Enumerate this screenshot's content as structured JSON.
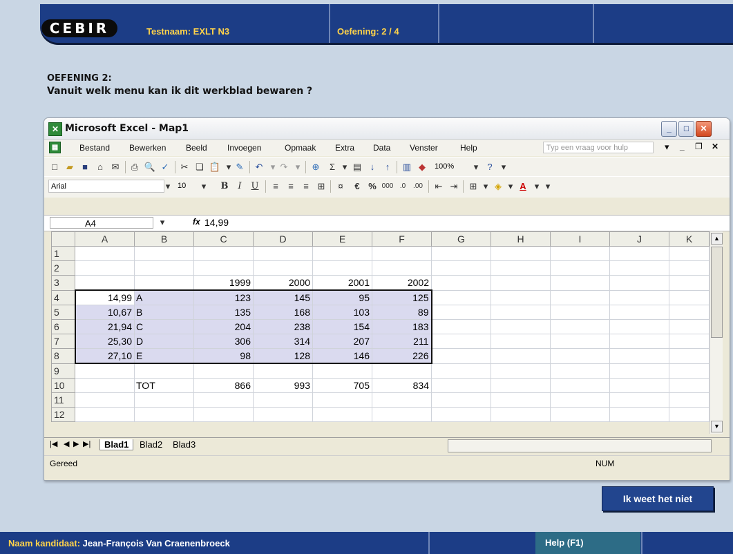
{
  "header": {
    "logo": "CEBIR",
    "test_label": "Testnaam: EXLT N3",
    "exercise_label": "Oefening: 2 / 4"
  },
  "question": {
    "title": "OEFENING 2:",
    "text": "Vanuit welk menu kan ik dit werkblad bewaren ?"
  },
  "excel": {
    "window_title": "Microsoft Excel - Map1",
    "menus": [
      "Bestand",
      "Bewerken",
      "Beeld",
      "Invoegen",
      "Opmaak",
      "Extra",
      "Data",
      "Venster",
      "Help"
    ],
    "help_placeholder": "Typ een vraag voor hulp",
    "zoom": "100%",
    "font_name": "Arial",
    "font_size": "10",
    "name_box": "A4",
    "formula_value": "14,99",
    "fx": "fx",
    "columns": [
      "A",
      "B",
      "C",
      "D",
      "E",
      "F",
      "G",
      "H",
      "I",
      "J",
      "K"
    ],
    "rows": [
      {
        "n": "1",
        "cells": [
          "",
          "",
          "",
          "",
          "",
          ""
        ]
      },
      {
        "n": "2",
        "cells": [
          "",
          "",
          "",
          "",
          "",
          ""
        ]
      },
      {
        "n": "3",
        "cells": [
          "",
          "",
          "1999",
          "2000",
          "2001",
          "2002"
        ]
      },
      {
        "n": "4",
        "cells": [
          "14,99",
          "A",
          "123",
          "145",
          "95",
          "125"
        ]
      },
      {
        "n": "5",
        "cells": [
          "10,67",
          "B",
          "135",
          "168",
          "103",
          "89"
        ]
      },
      {
        "n": "6",
        "cells": [
          "21,94",
          "C",
          "204",
          "238",
          "154",
          "183"
        ]
      },
      {
        "n": "7",
        "cells": [
          "25,30",
          "D",
          "306",
          "314",
          "207",
          "211"
        ]
      },
      {
        "n": "8",
        "cells": [
          "27,10",
          "E",
          "98",
          "128",
          "146",
          "226"
        ]
      },
      {
        "n": "9",
        "cells": [
          "",
          "",
          "",
          "",
          "",
          ""
        ]
      },
      {
        "n": "10",
        "cells": [
          "",
          "TOT",
          "866",
          "993",
          "705",
          "834"
        ]
      },
      {
        "n": "11",
        "cells": [
          "",
          "",
          "",
          "",
          "",
          ""
        ]
      },
      {
        "n": "12",
        "cells": [
          "",
          "",
          "",
          "",
          "",
          ""
        ]
      }
    ],
    "sheets": [
      "Blad1",
      "Blad2",
      "Blad3"
    ],
    "active_sheet": "Blad1",
    "status": "Gereed",
    "status_num": "NUM"
  },
  "buttons": {
    "dont_know": "Ik weet het niet"
  },
  "footer": {
    "candidate_label": "Naam kandidaat:",
    "candidate_name": "Jean-François Van Craenenbroeck",
    "help": "Help (F1)"
  }
}
